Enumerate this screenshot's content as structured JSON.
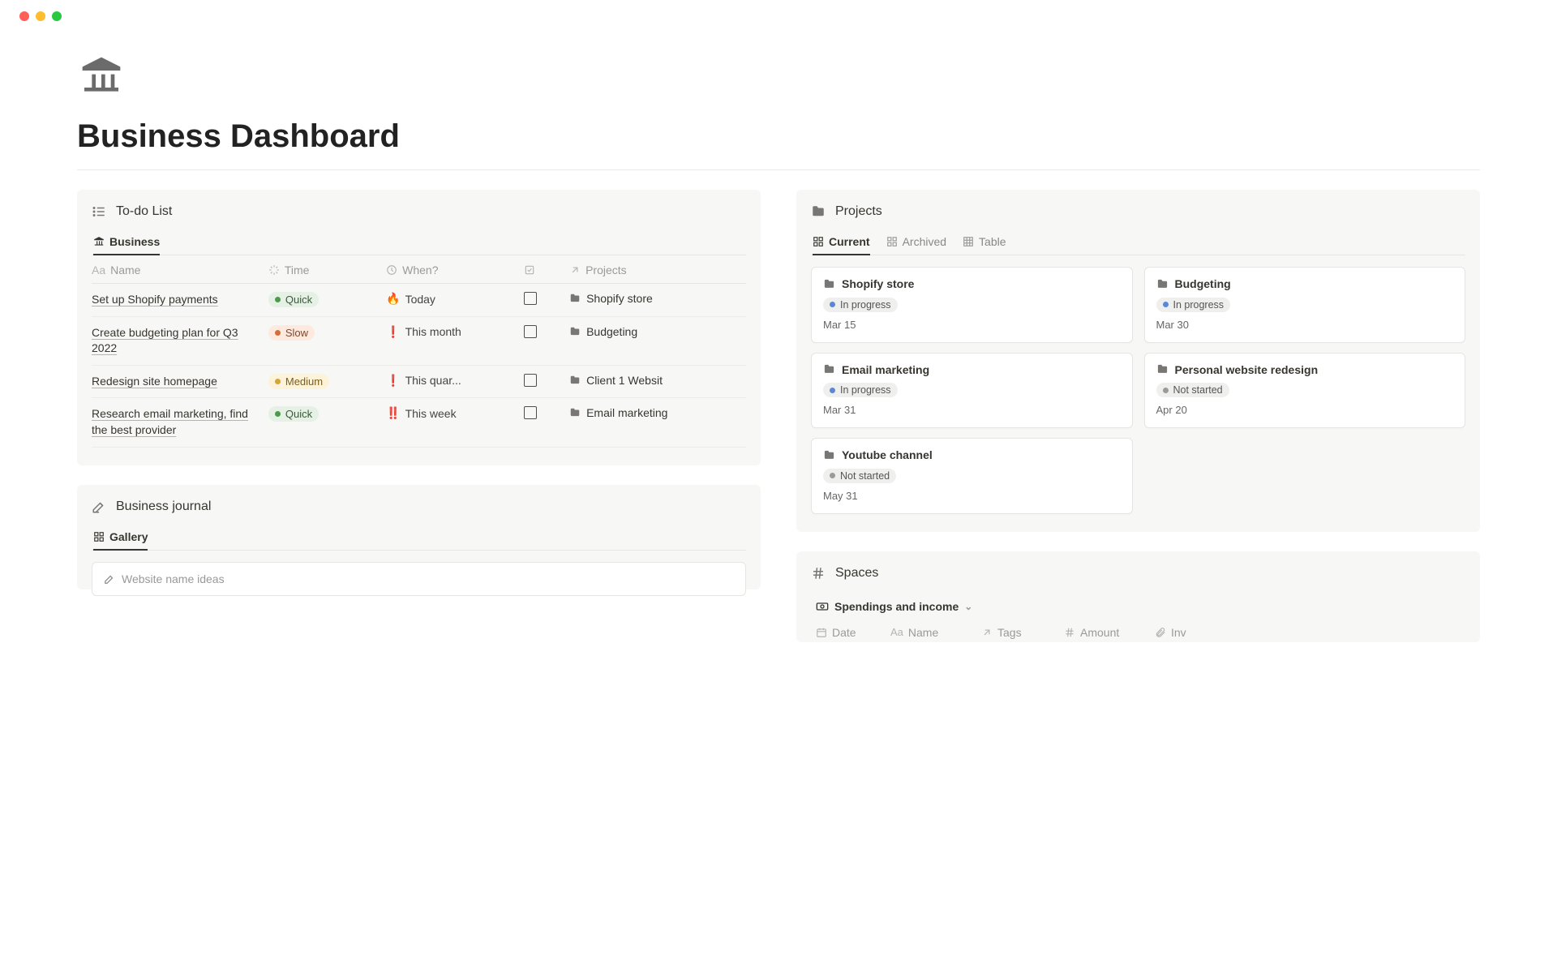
{
  "page": {
    "title": "Business Dashboard"
  },
  "todo": {
    "title": "To-do List",
    "tab_business": "Business",
    "cols": {
      "name": "Name",
      "time": "Time",
      "when": "When?",
      "projects": "Projects"
    },
    "rows": [
      {
        "name": "Set up Shopify payments",
        "time_label": "Quick",
        "time_class": "pill-quick",
        "when_icon": "🔥",
        "when": "Today",
        "project": "Shopify store"
      },
      {
        "name": "Create budgeting plan for Q3 2022",
        "time_label": "Slow",
        "time_class": "pill-slow",
        "when_icon": "❗",
        "when": "This month",
        "project": "Budgeting"
      },
      {
        "name": "Redesign site homepage",
        "time_label": "Medium",
        "time_class": "pill-medium",
        "when_icon": "❗",
        "when": "This quar...",
        "project": "Client 1 Websit"
      },
      {
        "name": "Research email marketing, find the best provider",
        "time_label": "Quick",
        "time_class": "pill-quick",
        "when_icon": "‼️",
        "when": "This week",
        "project": "Email marketing"
      }
    ]
  },
  "journal": {
    "title": "Business journal",
    "tab_gallery": "Gallery",
    "card_title": "Website name ideas"
  },
  "projects": {
    "title": "Projects",
    "tab_current": "Current",
    "tab_archived": "Archived",
    "tab_table": "Table",
    "cards": [
      {
        "title": "Shopify store",
        "status": "In progress",
        "status_class": "in-progress",
        "date": "Mar 15"
      },
      {
        "title": "Budgeting",
        "status": "In progress",
        "status_class": "in-progress",
        "date": "Mar 30"
      },
      {
        "title": "Email marketing",
        "status": "In progress",
        "status_class": "in-progress",
        "date": "Mar 31"
      },
      {
        "title": "Personal website redesign",
        "status": "Not started",
        "status_class": "not-started",
        "date": "Apr 20"
      },
      {
        "title": "Youtube channel",
        "status": "Not started",
        "status_class": "not-started",
        "date": "May 31"
      }
    ]
  },
  "spaces": {
    "title": "Spaces",
    "view": "Spendings and income",
    "cols": {
      "date": "Date",
      "name": "Name",
      "tags": "Tags",
      "amount": "Amount",
      "invoice": "Inv"
    }
  }
}
